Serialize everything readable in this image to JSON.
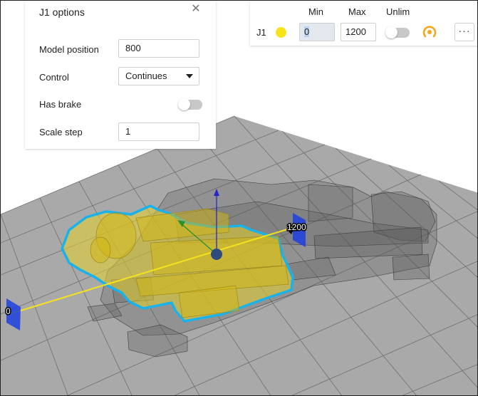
{
  "options_panel": {
    "title": "J1 options",
    "close_icon": "close-icon",
    "rows": {
      "model_position": {
        "label": "Model position",
        "value": "800"
      },
      "control": {
        "label": "Control",
        "value": "Continues"
      },
      "has_brake": {
        "label": "Has brake",
        "checked": false
      },
      "scale_step": {
        "label": "Scale step",
        "value": "1"
      }
    }
  },
  "joint_bar": {
    "headers": {
      "min": "Min",
      "max": "Max",
      "unlim": "Unlim"
    },
    "joint": {
      "name": "J1",
      "color": "#f7e31a",
      "min": "0",
      "max": "1200",
      "unlimited": false,
      "limits_icon": "joint-limits-icon",
      "more_icon": "more-icon",
      "more_label": "···"
    }
  },
  "viewport": {
    "axis_start_label": "0",
    "axis_end_label": "1200",
    "axis_color": "#f5e21c",
    "highlight_color": "#1ab2ea"
  }
}
